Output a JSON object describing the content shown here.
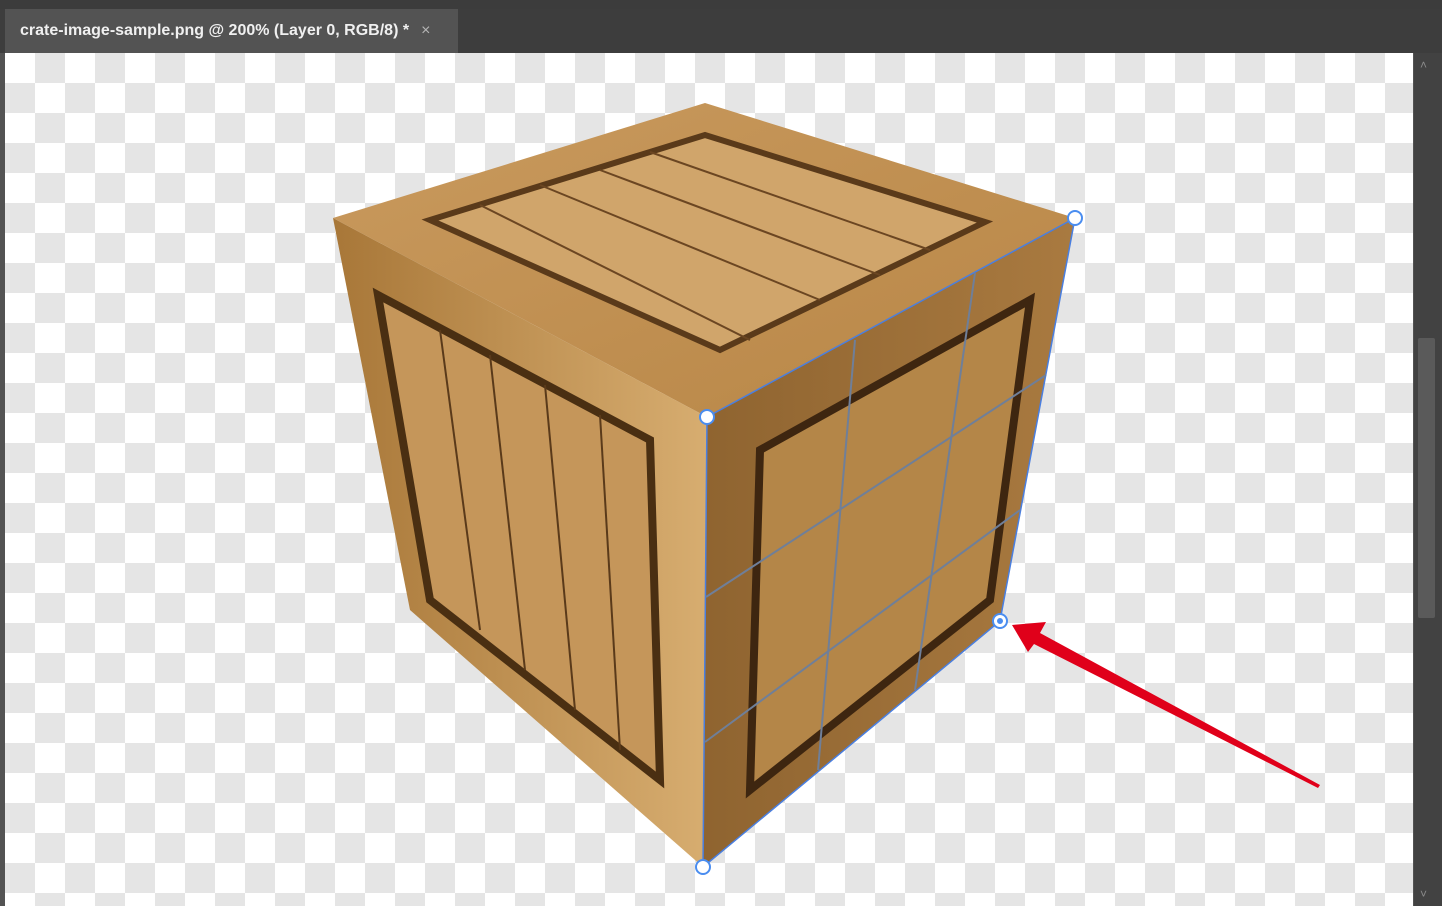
{
  "document_tab": {
    "title": "crate-image-sample.png @ 200% (Layer 0, RGB/8) *",
    "close_icon": "×"
  },
  "scrollbar": {
    "up": "˄",
    "down": "˅"
  },
  "colors": {
    "handle": "#4a8df0",
    "annotation_arrow": "#e0001a"
  }
}
